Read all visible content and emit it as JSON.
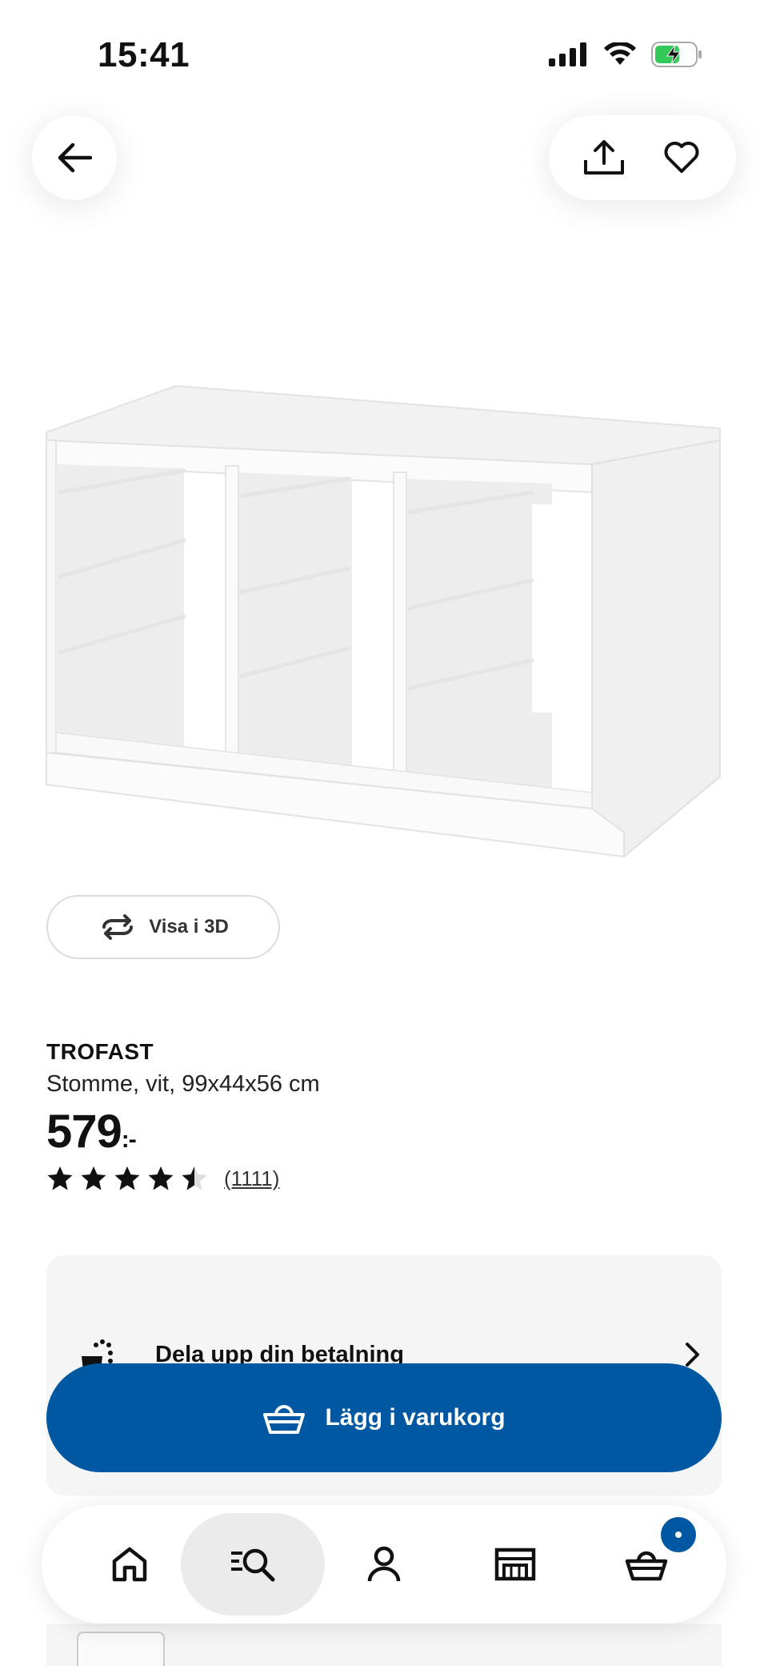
{
  "status_bar": {
    "time": "15:41"
  },
  "header": {
    "back_icon": "arrow-left-icon",
    "share_icon": "share-icon",
    "favorite_icon": "heart-icon"
  },
  "product": {
    "view_3d_label": "Visa i 3D",
    "name": "TROFAST",
    "description": "Stomme, vit, 99x44x56 cm",
    "price": "579",
    "price_suffix": ":-",
    "rating_value": 4.5,
    "rating_max": 5,
    "review_count": "(1111)"
  },
  "payment": {
    "label": "Dela upp din betalning"
  },
  "cart_button": {
    "label": "Lägg i varukorg"
  },
  "bottom_nav": {
    "items": [
      {
        "icon": "home-icon"
      },
      {
        "icon": "search-icon",
        "active": true
      },
      {
        "icon": "profile-icon"
      },
      {
        "icon": "store-icon"
      },
      {
        "icon": "basket-icon"
      }
    ]
  },
  "colors": {
    "brand_blue": "#0058a3",
    "card_bg": "#f5f5f5"
  }
}
